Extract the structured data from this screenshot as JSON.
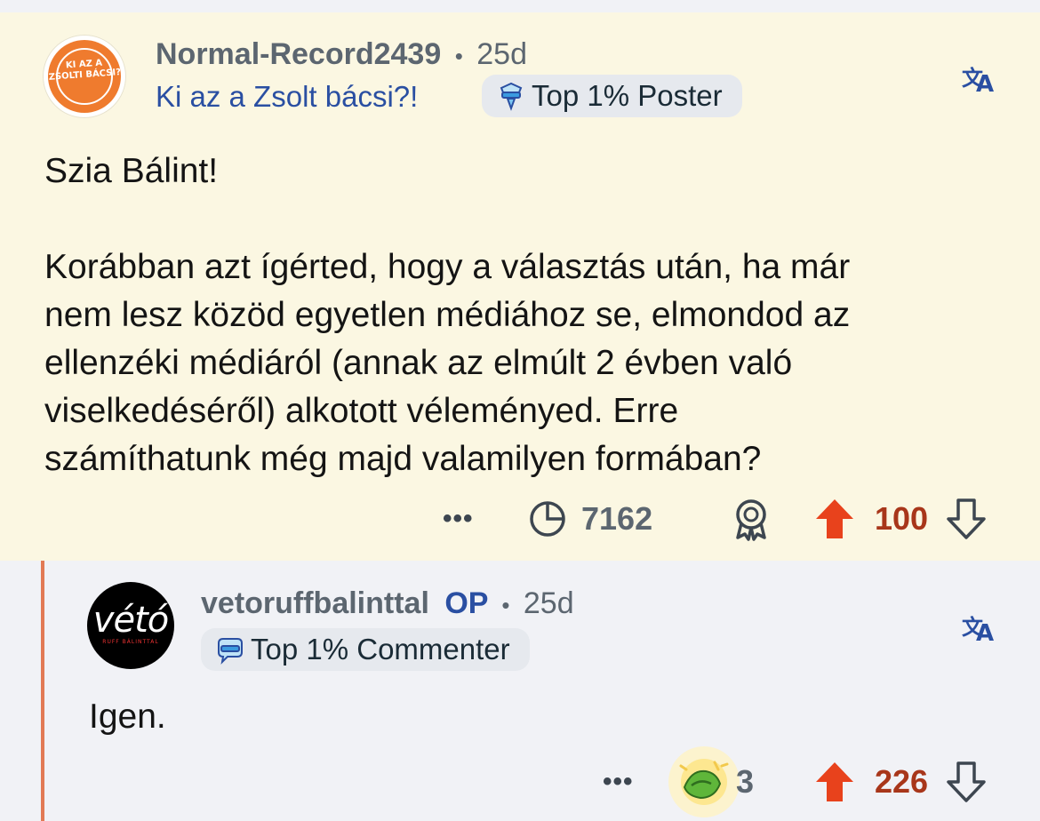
{
  "comment1": {
    "avatar_text": "KI AZ A ZSOLTI BÁCSI?",
    "username": "Normal-Record2439",
    "separator": "•",
    "age": "25d",
    "flair": "Ki az a Zsolt bácsi?!",
    "badge": "Top 1% Poster",
    "paragraphs": [
      "Szia Bálint!",
      "Korábban azt ígérted, hogy a választás után, ha már\nnem lesz közöd egyetlen médiához se, elmondod az\nellenzéki médiáról (annak az elmúlt 2 évben való\nviselkedéséről) alkotott véleményed. Erre\nszámíthatunk még majd valamilyen formában?"
    ],
    "more": "•••",
    "views": "7162",
    "votes": "100"
  },
  "comment2": {
    "avatar_logo": "vétó",
    "avatar_sub": "RUFF BÁLINTTAL",
    "username": "vetoruffbalinttal",
    "op": "OP",
    "separator": "•",
    "age": "25d",
    "badge": "Top 1% Commenter",
    "body": "Igen.",
    "more": "•••",
    "award_count": "3",
    "votes": "226"
  },
  "colors": {
    "highlight_bg": "#fbf7e2",
    "page_bg": "#f1f2f6",
    "flair_blue": "#2a4fa2",
    "upvote_orange": "#e8421c",
    "vote_count_red": "#a8361a",
    "thread_line": "#e27a55"
  },
  "icons": [
    "translate-icon",
    "views-icon",
    "award-icon",
    "upvote-icon",
    "downvote-icon",
    "wholesome-award-icon",
    "poster-badge-icon",
    "commenter-badge-icon"
  ]
}
